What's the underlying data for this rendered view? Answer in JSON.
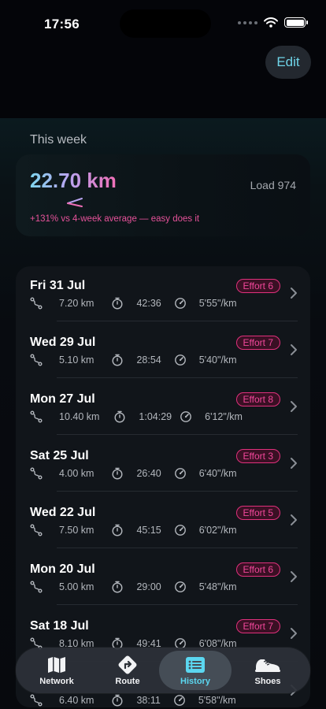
{
  "status": {
    "time": "17:56"
  },
  "header": {
    "edit_label": "Edit"
  },
  "week": {
    "section_title": "This week",
    "distance": "22.70 km",
    "load": "Load 974",
    "comparison": "+131% vs 4-week average — easy does it"
  },
  "runs": [
    {
      "date": "Fri 31 Jul",
      "effort": "Effort 6",
      "distance": "7.20 km",
      "duration": "42:36",
      "pace": "5'55\"/km"
    },
    {
      "date": "Wed 29 Jul",
      "effort": "Effort 7",
      "distance": "5.10 km",
      "duration": "28:54",
      "pace": "5'40\"/km"
    },
    {
      "date": "Mon 27 Jul",
      "effort": "Effort 8",
      "distance": "10.40 km",
      "duration": "1:04:29",
      "pace": "6'12\"/km"
    },
    {
      "date": "Sat 25 Jul",
      "effort": "Effort 3",
      "distance": "4.00 km",
      "duration": "26:40",
      "pace": "6'40\"/km"
    },
    {
      "date": "Wed 22 Jul",
      "effort": "Effort 5",
      "distance": "7.50 km",
      "duration": "45:15",
      "pace": "6'02\"/km"
    },
    {
      "date": "Mon 20 Jul",
      "effort": "Effort 6",
      "distance": "5.00 km",
      "duration": "29:00",
      "pace": "5'48\"/km"
    },
    {
      "date": "Sat 18 Jul",
      "effort": "Effort 7",
      "distance": "8.10 km",
      "duration": "49:41",
      "pace": "6'08\"/km"
    },
    {
      "date": "",
      "effort": "",
      "distance": "6.40 km",
      "duration": "38:11",
      "pace": "5'58\"/km"
    }
  ],
  "tabs": [
    {
      "label": "Network",
      "icon": "map-icon",
      "active": false
    },
    {
      "label": "Route",
      "icon": "route-sign-icon",
      "active": false
    },
    {
      "label": "History",
      "icon": "list-icon",
      "active": true
    },
    {
      "label": "Shoes",
      "icon": "sneaker-icon",
      "active": false
    }
  ],
  "colors": {
    "accent": "#5bd7f0",
    "effort": "#f0479a",
    "distance_gradient": [
      "#7fd6ee",
      "#f06fb7"
    ]
  }
}
